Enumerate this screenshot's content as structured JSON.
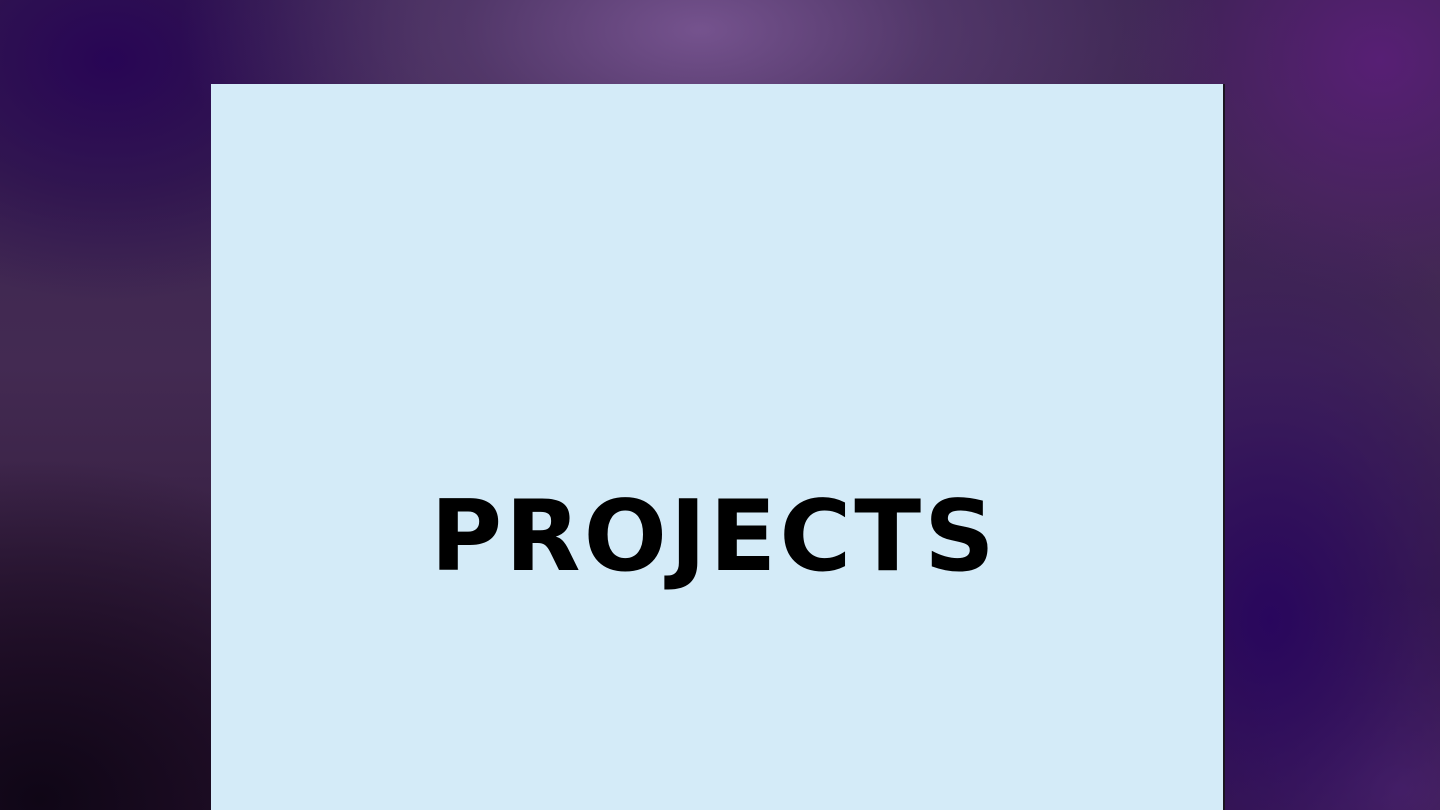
{
  "page": {
    "section_title": "PROJECTS"
  },
  "colors": {
    "panel_background": "#d4ebf8",
    "title_text": "#000000",
    "desktop_primary": "#3a1f4f",
    "desktop_accent": "#2a0a5e"
  }
}
